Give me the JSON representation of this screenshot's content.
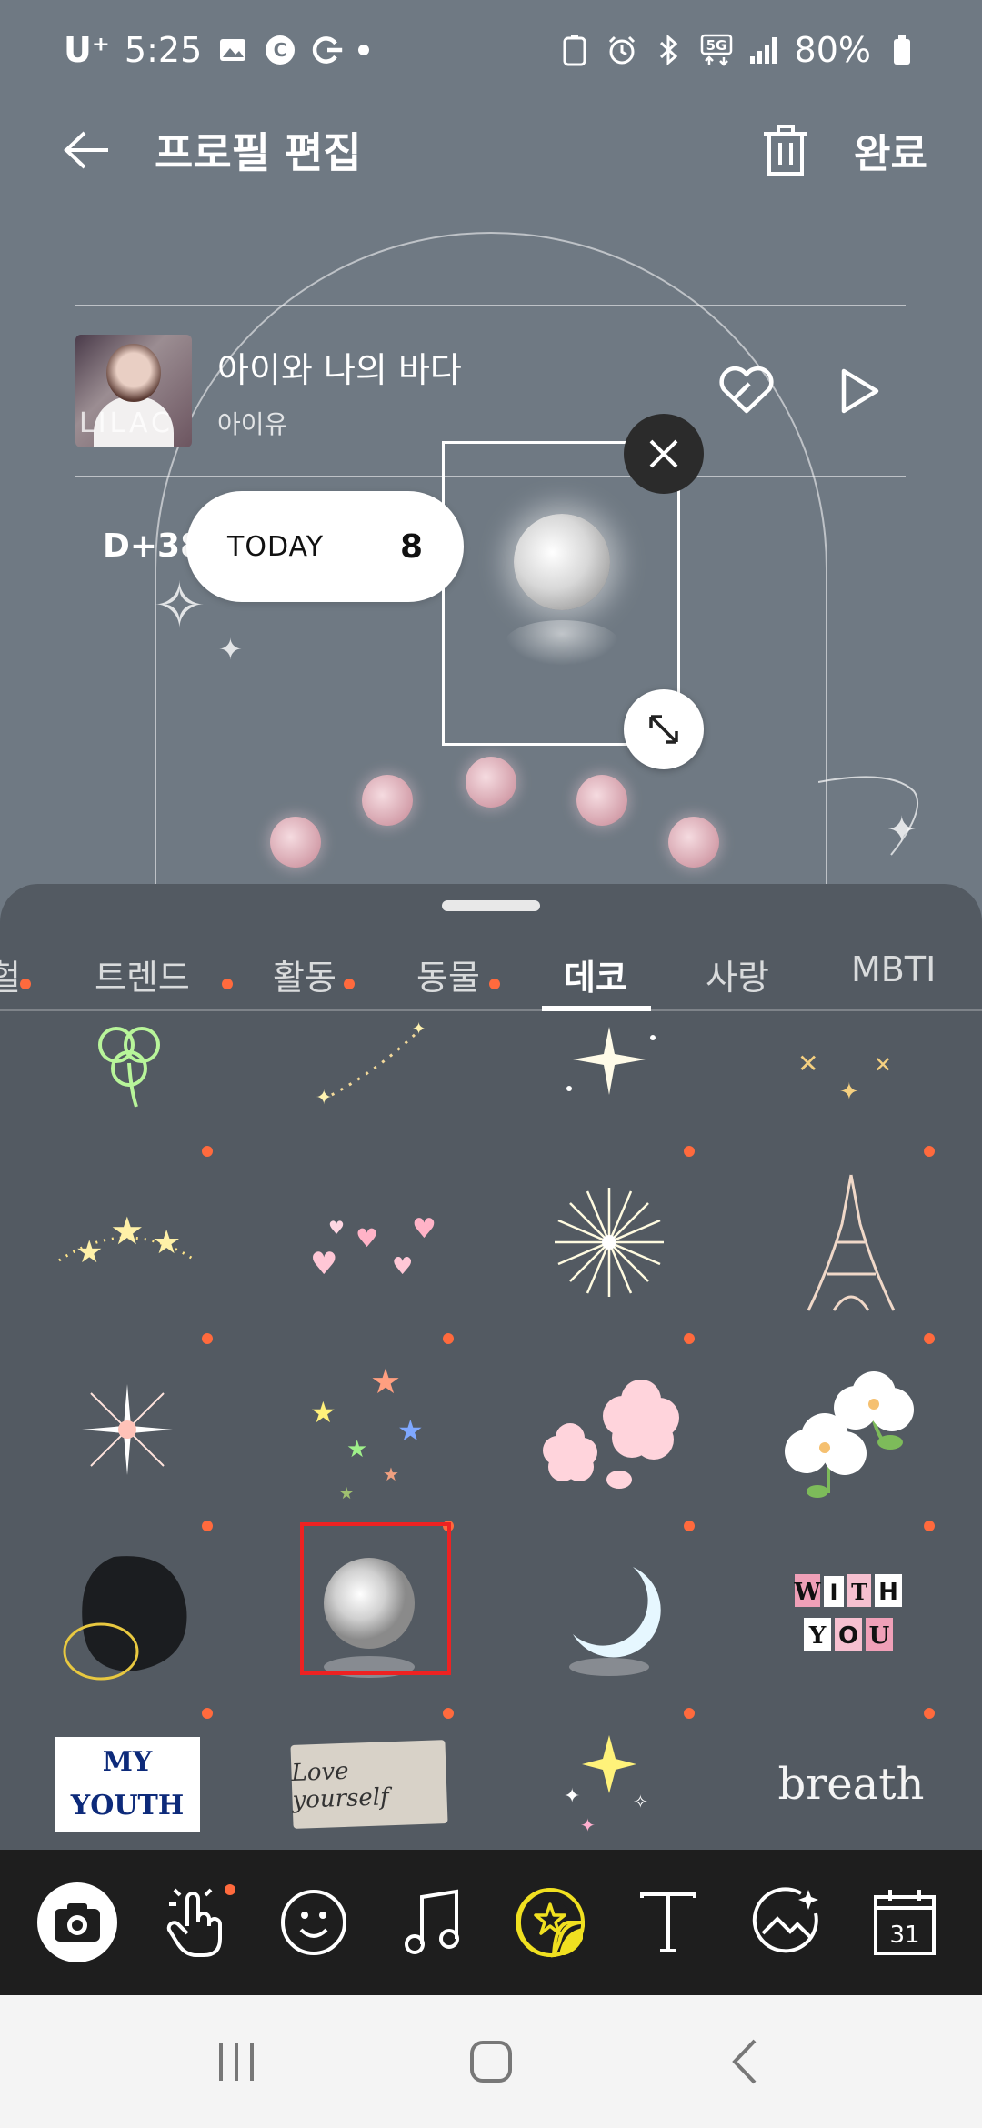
{
  "status": {
    "carrier": "U⁺",
    "time": "5:25",
    "battery": "80%",
    "network": "5G"
  },
  "header": {
    "title": "프로필 편집",
    "done_label": "완료"
  },
  "music": {
    "title": "아이와 나의 바다",
    "artist": "아이유",
    "album_text": "LILAC"
  },
  "today": {
    "dday": "D+38",
    "label": "TODAY",
    "count": "8"
  },
  "tabs": [
    {
      "label": "헐"
    },
    {
      "label": "트렌드"
    },
    {
      "label": "활동"
    },
    {
      "label": "동물"
    },
    {
      "label": "데코"
    },
    {
      "label": "사랑"
    },
    {
      "label": "MBTI"
    }
  ],
  "stickers": {
    "with_you": [
      "W",
      "I",
      "T",
      "H",
      "Y",
      "O",
      "U"
    ],
    "my_youth": "MY YOUTH",
    "love_yourself": "Love yourself",
    "breath": "breath"
  },
  "toolbar": {
    "calendar_day": "31"
  },
  "colors": {
    "accent_dot": "#ff6a3d",
    "selected": "#e22222",
    "sticker_tool": "#f0e020"
  }
}
